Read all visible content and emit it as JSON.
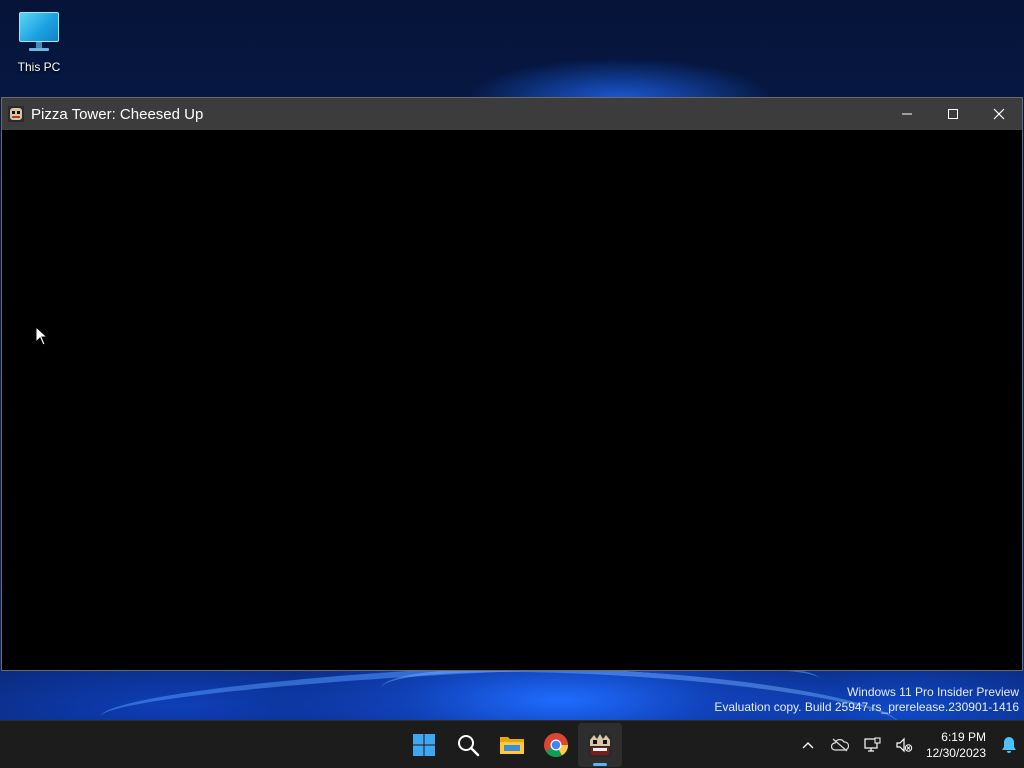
{
  "desktop": {
    "icons": [
      {
        "label": "This PC",
        "icon": "this-pc-icon"
      }
    ]
  },
  "window": {
    "title": "Pizza Tower: Cheesed Up",
    "icon": "pizza-tower-app-icon",
    "controls": [
      "minimize-icon",
      "maximize-icon",
      "close-icon"
    ]
  },
  "watermark": {
    "line1": "Windows 11 Pro Insider Preview",
    "line2": "Evaluation copy. Build 25947.rs_prerelease.230901-1416"
  },
  "taskbar": {
    "pinned": [
      "windows-start-icon",
      "search-icon",
      "file-explorer-icon",
      "chrome-icon",
      "pizza-tower-taskbar-icon"
    ],
    "active": "pizza-tower-taskbar-icon",
    "tray": {
      "icons": [
        "show-hidden-icons-chevron",
        "onedrive-offline-icon",
        "network-icon",
        "volume-muted-icon",
        "notification-bell-icon"
      ],
      "time": "6:19 PM",
      "date": "12/30/2023"
    }
  },
  "colors": {
    "accent": "#5fb2f2",
    "taskbar": "#1c1c1c",
    "titlebar": "#3c3c3c"
  }
}
